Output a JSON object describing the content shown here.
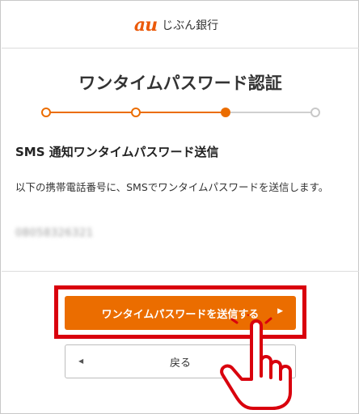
{
  "header": {
    "logo_mark": "au",
    "logo_text": "じぶん銀行"
  },
  "page": {
    "title": "ワンタイムパスワード認証"
  },
  "stepper": {
    "total_steps": 4,
    "current_step": 3,
    "active_color": "#eb6d00",
    "inactive_color": "#d0d0d0"
  },
  "section": {
    "title": "SMS 通知ワンタイムパスワード送信",
    "description": "以下の携帯電話番号に、SMSでワンタイムパスワードを送信します。",
    "phone_number": "08058326321"
  },
  "buttons": {
    "send_label": "ワンタイムパスワードを送信する",
    "send_icon": "triangle-right-icon",
    "back_label": "戻る",
    "back_icon": "triangle-left-icon"
  },
  "annotation": {
    "highlight_color": "#d9000d",
    "pointer_icon": "pointing-hand-icon"
  }
}
